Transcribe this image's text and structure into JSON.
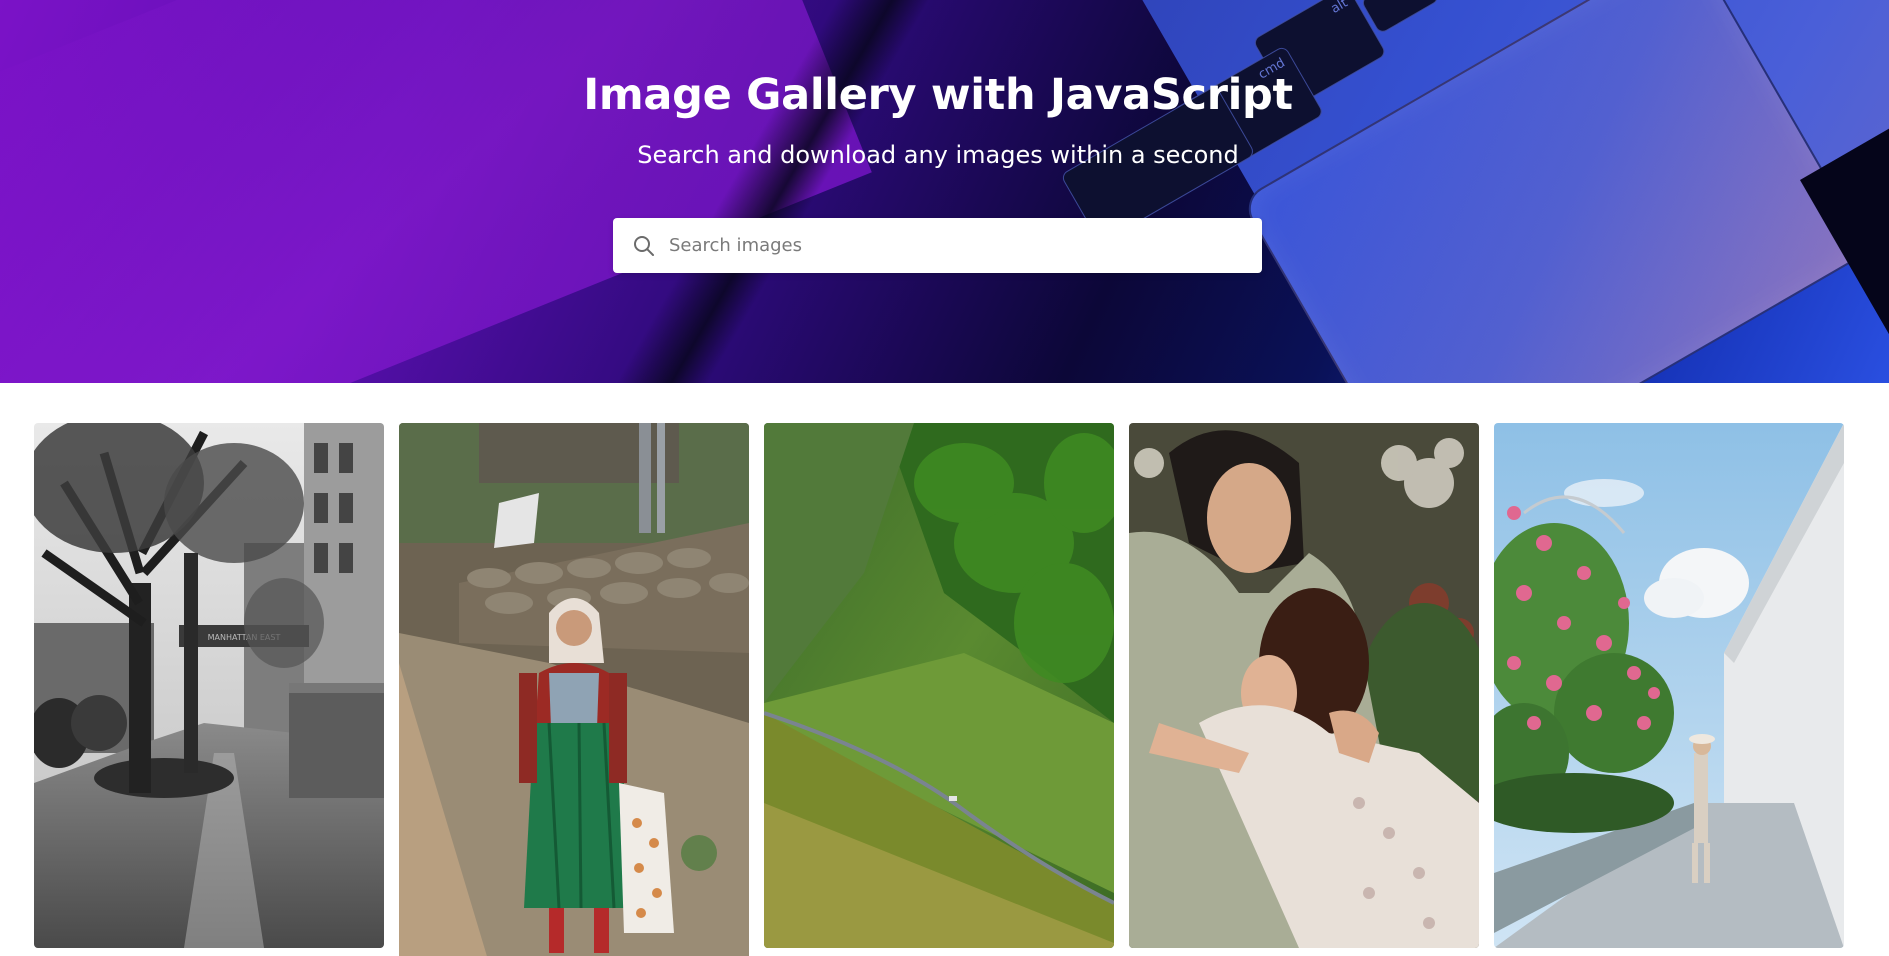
{
  "hero": {
    "title": "Image Gallery with JavaScript",
    "subtitle": "Search and download any images within a second",
    "keys": [
      "alt",
      "cmd"
    ],
    "colors": {
      "primary": "#5b0fb0",
      "accent": "#2a4fe0"
    }
  },
  "search": {
    "placeholder": "Search images",
    "value": "",
    "icon": "search-icon"
  },
  "gallery": {
    "images": [
      {
        "name": "city-sidewalk-bw",
        "sign_text": "MANHATTAN EAST"
      },
      {
        "name": "elderly-woman-headscarf"
      },
      {
        "name": "green-hillside-road"
      },
      {
        "name": "mother-and-daughter"
      },
      {
        "name": "woman-flowering-walkway"
      }
    ]
  }
}
